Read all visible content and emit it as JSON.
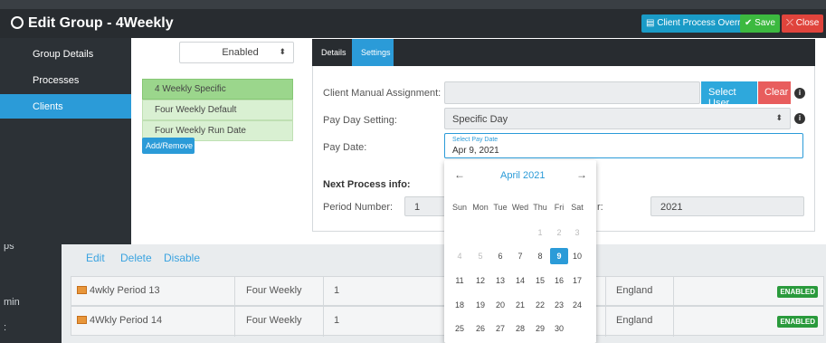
{
  "modal": {
    "title": "Edit Group - 4Weekly",
    "buttons": {
      "override": "Client Process Override",
      "save": "Save",
      "close": "Close"
    }
  },
  "sidebar": {
    "items": [
      {
        "label": "Group Details"
      },
      {
        "label": "Processes"
      },
      {
        "label": "Clients"
      }
    ]
  },
  "status_select": {
    "value": "Enabled"
  },
  "groups": [
    {
      "label": "4 Weekly Specific"
    },
    {
      "label": "Four Weekly Default"
    },
    {
      "label": "Four Weekly Run Date"
    }
  ],
  "add_remove": "Add/Remove",
  "tabs": [
    {
      "label": "Details"
    },
    {
      "label": "Settings"
    }
  ],
  "form": {
    "manual_assignment_label": "Client Manual Assignment:",
    "select_user": "Select User",
    "clear": "Clear",
    "pay_day_label": "Pay Day Setting:",
    "pay_day_value": "Specific Day",
    "pay_date_label": "Pay Date:",
    "pay_date_floating": "Select Pay Date",
    "pay_date_value": "Apr 9, 2021",
    "next_process": "Next Process info:",
    "period_number_label": "Period Number:",
    "period_number_value": "1",
    "year_label_tail": "r:",
    "year_value": "2021"
  },
  "datepicker": {
    "month": "April 2021",
    "prev": "←",
    "next": "→",
    "weekdays": [
      "Sun",
      "Mon",
      "Tue",
      "Wed",
      "Thu",
      "Fri",
      "Sat"
    ],
    "weeks": [
      [
        "",
        "",
        "",
        "",
        "1",
        "2",
        "3"
      ],
      [
        "4",
        "5",
        "6",
        "7",
        "8",
        "9",
        "10"
      ],
      [
        "11",
        "12",
        "13",
        "14",
        "15",
        "16",
        "17"
      ],
      [
        "18",
        "19",
        "20",
        "21",
        "22",
        "23",
        "24"
      ],
      [
        "25",
        "26",
        "27",
        "28",
        "29",
        "30",
        ""
      ]
    ],
    "selected": "9"
  },
  "background": {
    "left_labels": [
      "ps",
      "min",
      ":"
    ],
    "links": [
      "Edit",
      "Delete",
      "Disable"
    ],
    "rows": [
      {
        "name": "4wkly Period 13",
        "type": "Four Weekly",
        "num": "1",
        "region": "England",
        "status": "ENABLED"
      },
      {
        "name": "4Wkly Period 14",
        "type": "Four Weekly",
        "num": "1",
        "region": "England",
        "status": "ENABLED"
      }
    ]
  }
}
